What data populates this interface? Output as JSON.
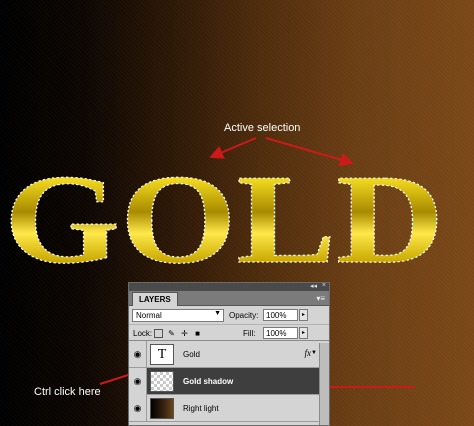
{
  "artwork": {
    "text": "GOLD",
    "selection_callout": "Active selection",
    "ctrl_callout": "Ctrl click here"
  },
  "layers_panel": {
    "tab_label": "LAYERS",
    "top_icons": {
      "collapse": "◂◂",
      "close": "×"
    },
    "menu_icon": "▾≡",
    "blend_mode": "Normal",
    "opacity_label": "Opacity:",
    "opacity_value": "100%",
    "lock_label": "Lock:",
    "fill_label": "Fill:",
    "fill_value": "100%",
    "layers": [
      {
        "name": "Gold",
        "thumb": "T",
        "fx": "fx",
        "selected": false
      },
      {
        "name": "Gold shadow",
        "thumb": "",
        "selected": true
      },
      {
        "name": "Right light",
        "thumb": "",
        "selected": false
      }
    ]
  },
  "colors": {
    "gold_light": "#f6e64a",
    "gold_dark": "#5a4a00",
    "arrow_red": "#cc1a1a",
    "selected_row": "#3e3e3e"
  }
}
